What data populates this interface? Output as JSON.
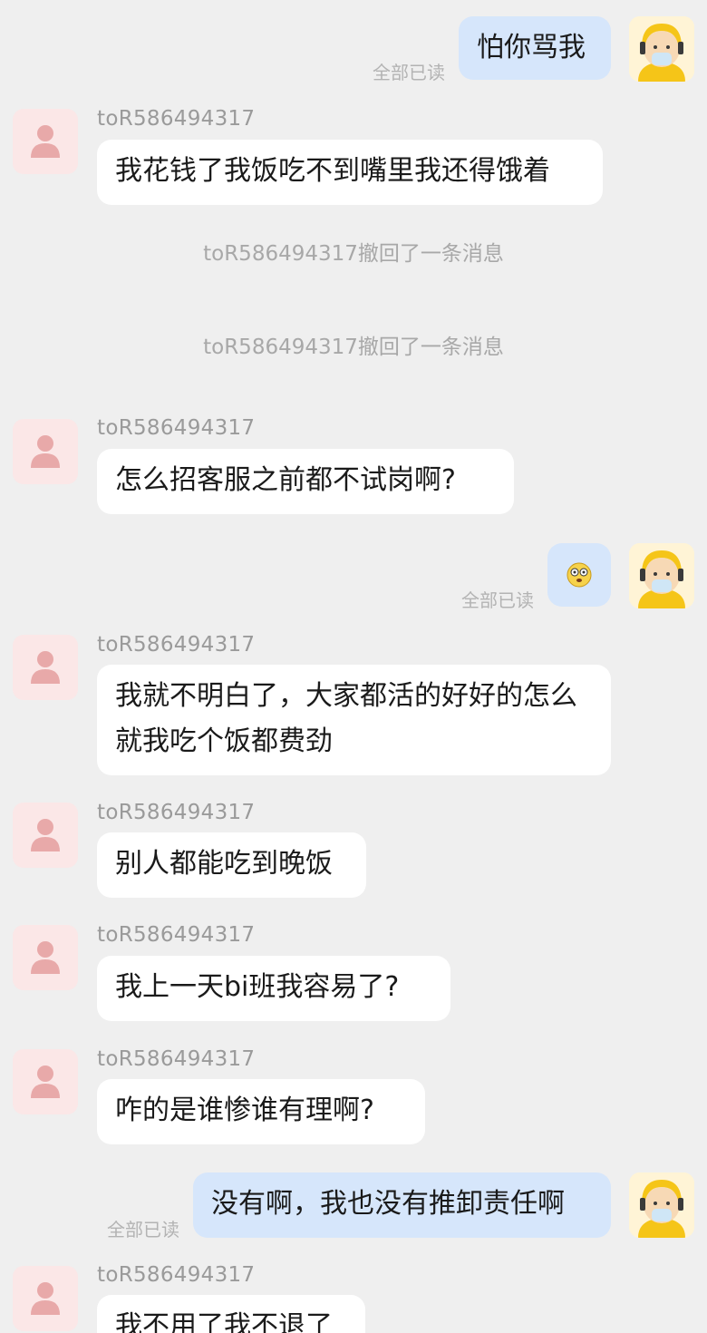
{
  "colors": {
    "background": "#efefef",
    "incoming_bubble": "#ffffff",
    "outgoing_bubble": "#d6e6fb",
    "incoming_avatar": "#fbe7e7"
  },
  "messages": [
    {
      "side": "out",
      "text": "怕你骂我",
      "read_label": "全部已读",
      "avatar": "delivery-rider-avatar"
    },
    {
      "side": "in",
      "sender": "toR586494317",
      "text": "我花钱了我饭吃不到嘴里我还得饿着",
      "avatar": "default-user-icon"
    },
    {
      "side": "system",
      "text": "toR586494317撤回了一条消息"
    },
    {
      "side": "system",
      "text": "toR586494317撤回了一条消息"
    },
    {
      "side": "in",
      "sender": "toR586494317",
      "text": "怎么招客服之前都不试岗啊?",
      "avatar": "default-user-icon"
    },
    {
      "side": "out",
      "emoji": "dizzy-face-emoji",
      "read_label": "全部已读",
      "avatar": "delivery-rider-avatar"
    },
    {
      "side": "in",
      "sender": "toR586494317",
      "text": "我就不明白了，大家都活的好好的怎么就我吃个饭都费劲",
      "avatar": "default-user-icon"
    },
    {
      "side": "in",
      "sender": "toR586494317",
      "text": "别人都能吃到晚饭",
      "avatar": "default-user-icon"
    },
    {
      "side": "in",
      "sender": "toR586494317",
      "text": "我上一天bi班我容易了?",
      "avatar": "default-user-icon"
    },
    {
      "side": "in",
      "sender": "toR586494317",
      "text": "咋的是谁惨谁有理啊?",
      "avatar": "default-user-icon"
    },
    {
      "side": "out",
      "text": "没有啊，我也没有推卸责任啊",
      "read_label": "全部已读",
      "avatar": "delivery-rider-avatar"
    },
    {
      "side": "in",
      "sender": "toR586494317",
      "text": "我不用了我不退了",
      "avatar": "default-user-icon"
    }
  ]
}
